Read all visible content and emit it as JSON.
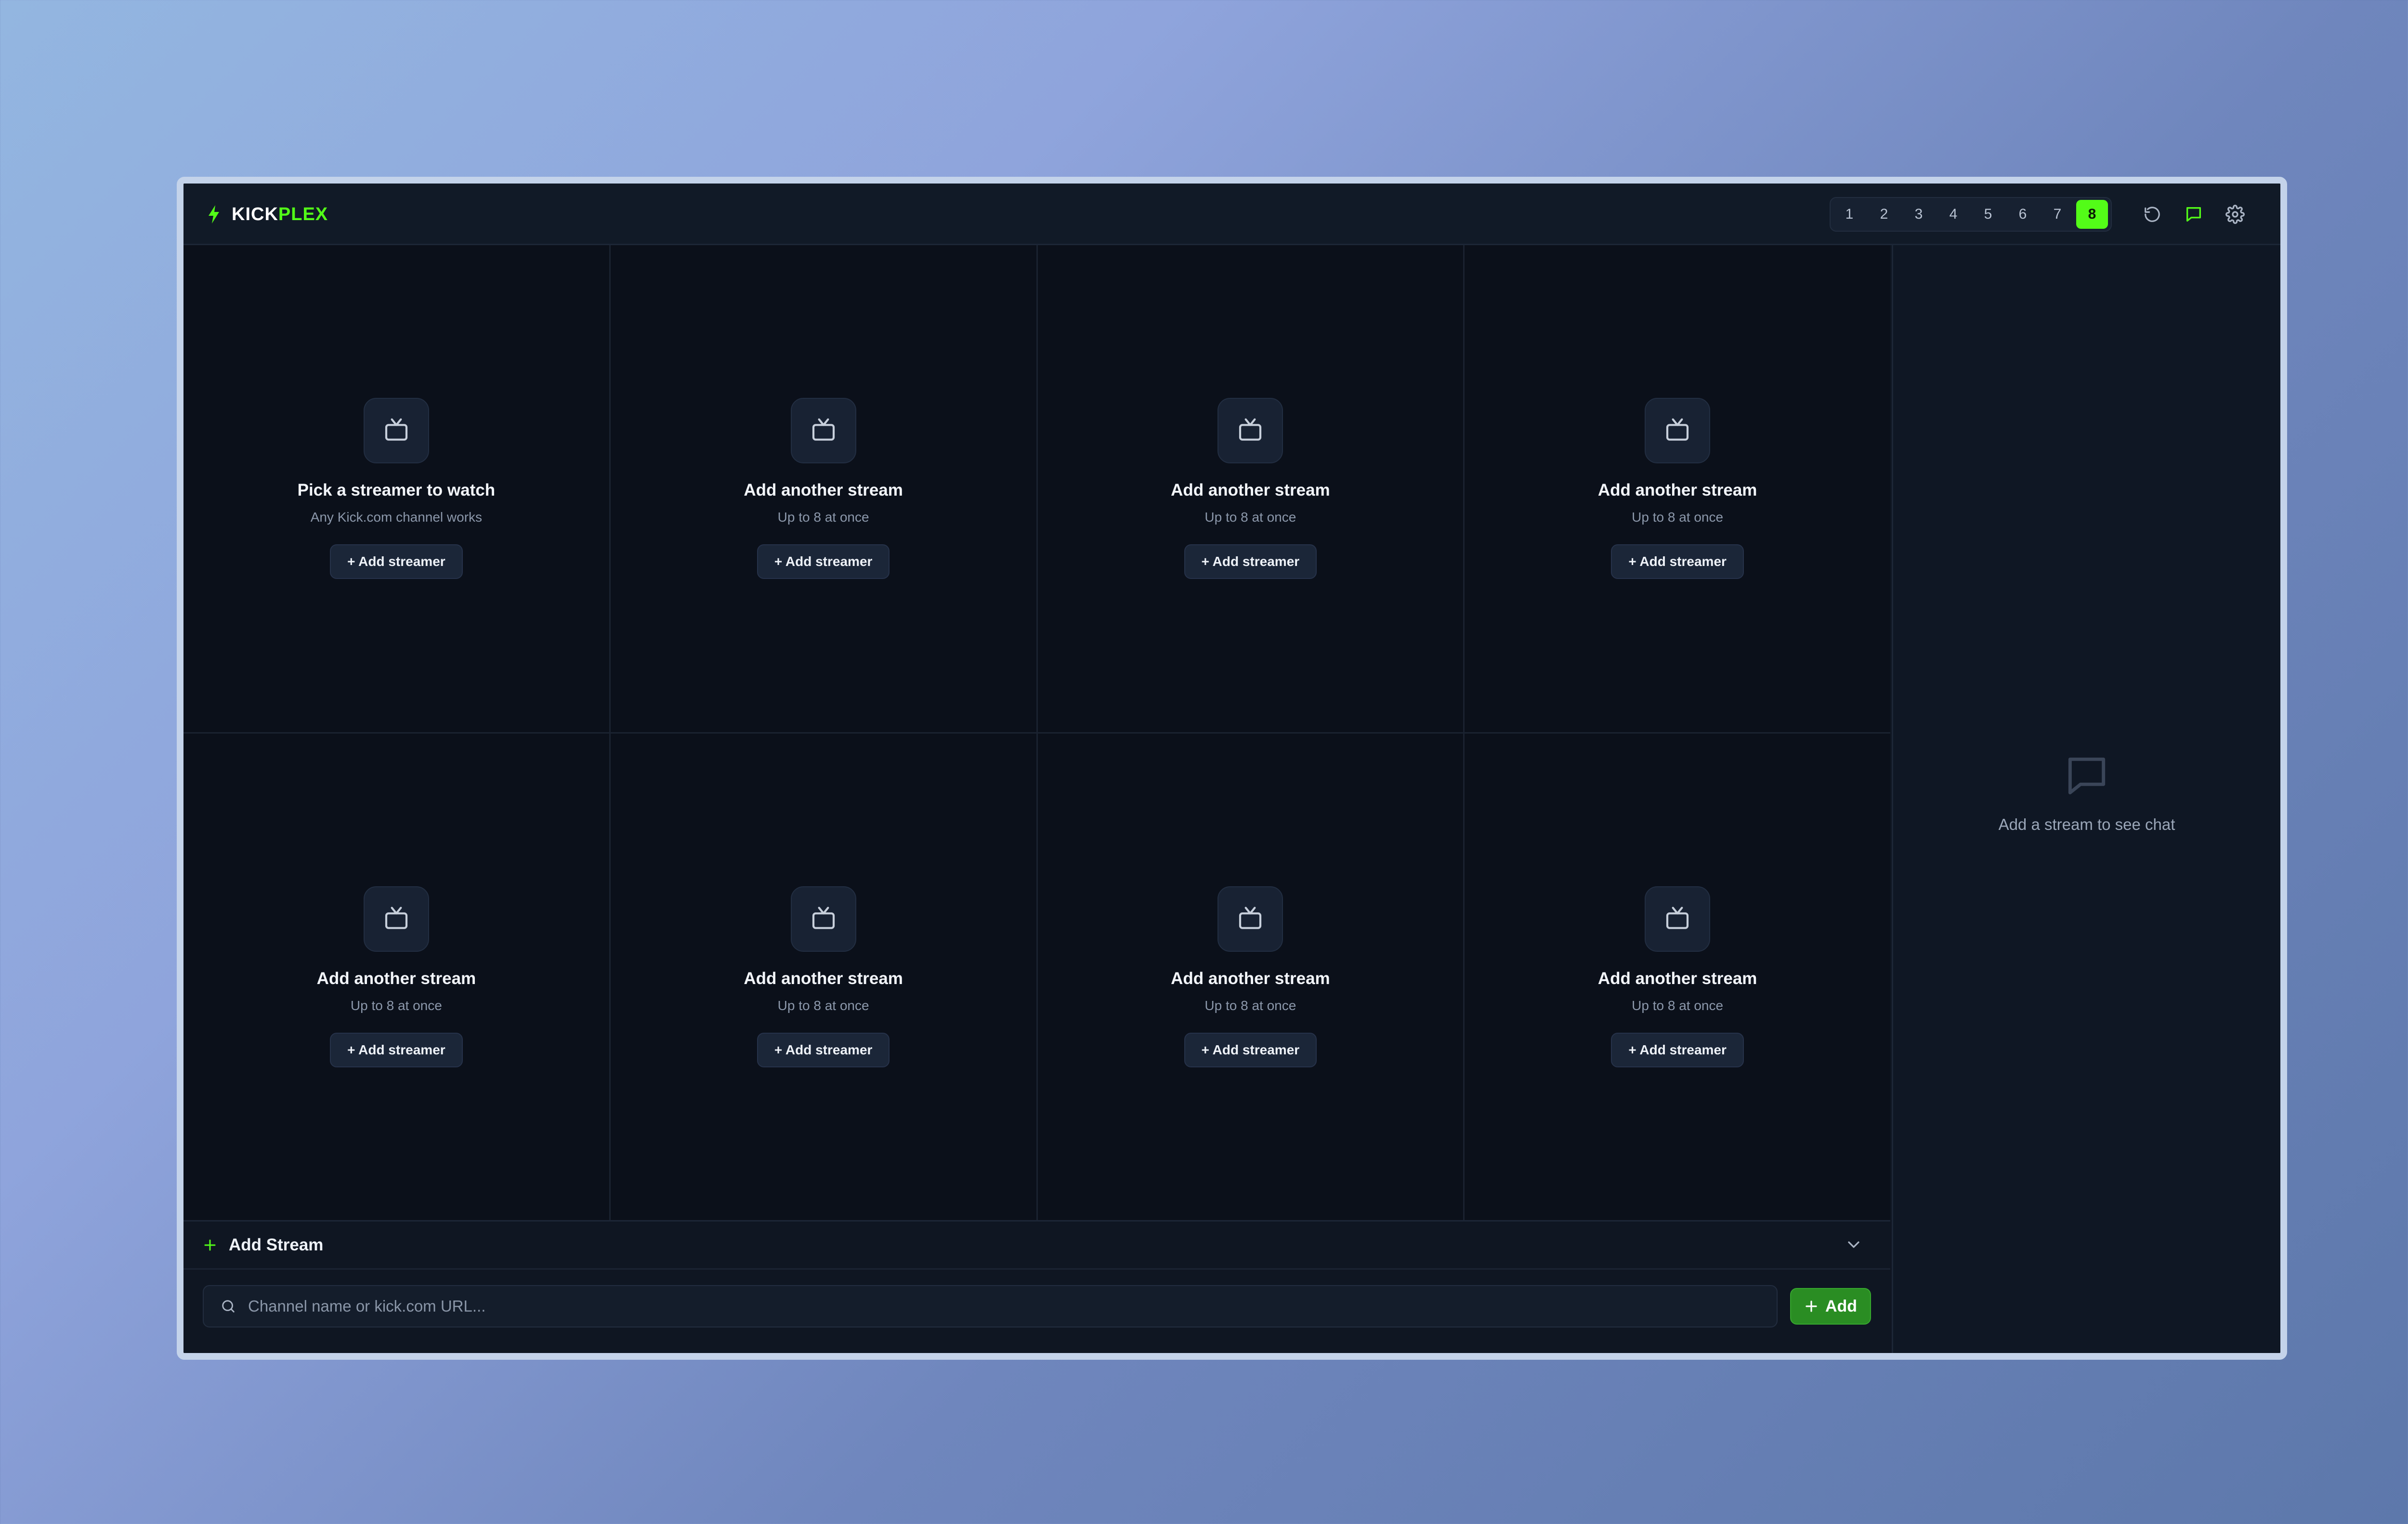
{
  "header": {
    "logo_part1": "KICK",
    "logo_part2": "PLEX",
    "accent_color": "#53fc18",
    "layout_options": [
      "1",
      "2",
      "3",
      "4",
      "5",
      "6",
      "7",
      "8"
    ],
    "active_layout": "8",
    "icons": [
      "bolt-icon",
      "reset-icon",
      "chat-icon",
      "gear-icon"
    ]
  },
  "tiles": [
    {
      "title": "Pick a streamer to watch",
      "subtitle": "Any Kick.com channel works",
      "button": "+ Add streamer"
    },
    {
      "title": "Add another stream",
      "subtitle": "Up to 8 at once",
      "button": "+ Add streamer"
    },
    {
      "title": "Add another stream",
      "subtitle": "Up to 8 at once",
      "button": "+ Add streamer"
    },
    {
      "title": "Add another stream",
      "subtitle": "Up to 8 at once",
      "button": "+ Add streamer"
    },
    {
      "title": "Add another stream",
      "subtitle": "Up to 8 at once",
      "button": "+ Add streamer"
    },
    {
      "title": "Add another stream",
      "subtitle": "Up to 8 at once",
      "button": "+ Add streamer"
    },
    {
      "title": "Add another stream",
      "subtitle": "Up to 8 at once",
      "button": "+ Add streamer"
    },
    {
      "title": "Add another stream",
      "subtitle": "Up to 8 at once",
      "button": "+ Add streamer"
    }
  ],
  "chat": {
    "empty_text": "Add a stream to see chat"
  },
  "add_stream": {
    "title": "Add Stream",
    "placeholder": "Channel name or kick.com URL...",
    "value": "",
    "button": "Add"
  }
}
